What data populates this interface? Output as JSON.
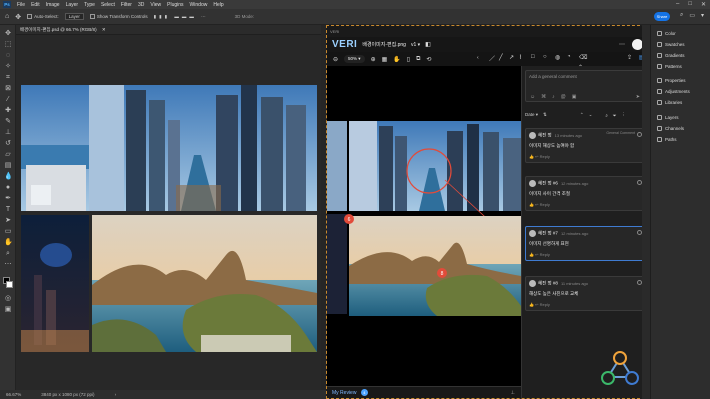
{
  "menubar": {
    "items": [
      "File",
      "Edit",
      "Image",
      "Layer",
      "Type",
      "Select",
      "Filter",
      "3D",
      "View",
      "Plugins",
      "Window",
      "Help"
    ]
  },
  "options": {
    "auto_select": "Auto-Select:",
    "layer": "Layer",
    "transform": "Show Transform Controls",
    "share": "Share"
  },
  "document": {
    "tab": "배경이미지-편집.psd @ 66.7% (RGB/8)",
    "zoom": "66.67%",
    "size": "3840 px x 1080 px (72 ppi)"
  },
  "ps_panels": [
    {
      "label": "Color"
    },
    {
      "label": "Swatches"
    },
    {
      "label": "Gradients"
    },
    {
      "label": "Patterns"
    },
    {
      "label": "Properties"
    },
    {
      "label": "Adjustments"
    },
    {
      "label": "Libraries"
    },
    {
      "label": "Layers"
    },
    {
      "label": "Channels"
    },
    {
      "label": "Paths"
    }
  ],
  "veri": {
    "top_label": "VERI",
    "logo": "VERI",
    "filename": "배경이미지-편집.png",
    "version": "v1",
    "zoom": "50%",
    "my_review": "My Review",
    "review_count": "4",
    "comment_placeholder": "Add a general comment",
    "sort_label": "Date",
    "general_tag": "General Comment",
    "reply_label": "Reply",
    "comments": [
      {
        "author": "혜진 정",
        "time": "13 minutes ago",
        "body": "이미지 해상도 높여야 함",
        "tag": "General Comment"
      },
      {
        "author": "혜진 정 #6",
        "time": "12 minutes ago",
        "body": "이미지 사이 간격 조절",
        "tag": ""
      },
      {
        "author": "혜진 정 #7",
        "time": "12 minutes ago",
        "body": "이미지 선명하게 표현",
        "tag": ""
      },
      {
        "author": "혜진 정 #8",
        "time": "11 minutes ago",
        "body": "해상도 높은 사진으로 교체",
        "tag": ""
      }
    ],
    "markers": [
      "6",
      "8"
    ]
  },
  "colors": {
    "accent": "#1473e6",
    "veri_border": "#c98a2e",
    "marker": "#e24b3a",
    "selected_card": "#3f7bd1"
  }
}
